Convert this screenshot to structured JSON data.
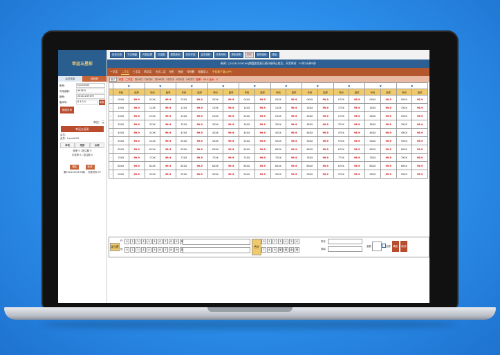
{
  "sidebar": {
    "logo": "幸运五星彩",
    "tabs": [
      "会员信息",
      "游戏规"
    ],
    "account": [
      {
        "k": "账号：",
        "v": "hyceshi05"
      },
      {
        "k": "可用余额：",
        "v": "9938.9"
      },
      {
        "k": "期号：",
        "v": "20241209199"
      },
      {
        "k": "版本号：",
        "v": "8.3.5.5"
      }
    ],
    "refresh_btn": "刷新",
    "balance_btn": "额度查询",
    "unit": "单位：元",
    "title_bar": "幸运五星彩",
    "info": [
      "会员：",
      "会员：hyceshi05"
    ],
    "stat_head": [
      "单笔",
      "限额",
      "余额"
    ],
    "stat_lines": [
      "赔率 0 | 投注额 0",
      "中奖率 0 | 投注额 0"
    ],
    "buttons": [
      "确定",
      "取消"
    ],
    "footer": "第20241209199期 ，开奖时间 07"
  },
  "topnav": {
    "items": [
      "历史记录",
      "下注明细",
      "开奖结果",
      "已结账",
      "报表查询",
      "历史开奖",
      "会员资料",
      "开奖号码",
      "规则说明",
      "打印",
      "修改密码",
      "退出"
    ],
    "active_index": 9
  },
  "notice": "新闻：[20241209199]期盘面信息已经开始停止投注，开奖时间：07时3分钟5秒",
  "playtabs": {
    "items": [
      "一字定",
      "二字定",
      "三字定",
      "四字定",
      "五位二定",
      "快打",
      "快选",
      "号码数",
      "批量导入",
      "手机端下载(APP)"
    ],
    "active_index": 1
  },
  "subtabs": [
    "模式",
    "开奖",
    "二字定",
    "口XX口",
    "口X口X",
    "口XXX口",
    "X口口X",
    "X口X口",
    "XX口口",
    "赔率：99.9 返水：0"
  ],
  "grid": {
    "header": [
      "号码",
      "赔率"
    ],
    "odds": "99.9",
    "columns": [
      [
        "00XX",
        "10XX",
        "20XX",
        "30XX",
        "40XX",
        "50XX",
        "60XX",
        "70XX",
        "80XX",
        "90XX"
      ],
      [
        "01XX",
        "11XX",
        "21XX",
        "31XX",
        "41XX",
        "51XX",
        "61XX",
        "71XX",
        "81XX",
        "91XX"
      ],
      [
        "02XX",
        "12XX",
        "22XX",
        "32XX",
        "42XX",
        "52XX",
        "62XX",
        "72XX",
        "82XX",
        "92XX"
      ],
      [
        "03XX",
        "13XX",
        "23XX",
        "33XX",
        "43XX",
        "53XX",
        "63XX",
        "73XX",
        "83XX",
        "93XX"
      ],
      [
        "04XX",
        "14XX",
        "24XX",
        "34XX",
        "44XX",
        "54XX",
        "64XX",
        "74XX",
        "84XX",
        "94XX"
      ],
      [
        "05XX",
        "15XX",
        "25XX",
        "35XX",
        "45XX",
        "55XX",
        "65XX",
        "75XX",
        "85XX",
        "95XX"
      ],
      [
        "06XX",
        "16XX",
        "26XX",
        "36XX",
        "46XX",
        "56XX",
        "66XX",
        "76XX",
        "86XX",
        "96XX"
      ],
      [
        "07XX",
        "17XX",
        "27XX",
        "37XX",
        "47XX",
        "57XX",
        "67XX",
        "77XX",
        "87XX",
        "97XX"
      ],
      [
        "08XX",
        "18XX",
        "28XX",
        "38XX",
        "48XX",
        "58XX",
        "68XX",
        "78XX",
        "88XX",
        "98XX"
      ],
      [
        "09XX",
        "19XX",
        "29XX",
        "39XX",
        "49XX",
        "59XX",
        "69XX",
        "79XX",
        "89XX",
        "99XX"
      ]
    ]
  },
  "panel": {
    "dingwei_label": "定位置",
    "row1_label": "仟",
    "row2_label": "佰",
    "digits": [
      "0",
      "1",
      "2",
      "3",
      "4",
      "5",
      "6",
      "7",
      "8",
      "9",
      "单",
      "双"
    ],
    "hefen_label": "合分",
    "hefen_digits": [
      "0",
      "1",
      "2",
      "3",
      "4",
      "5",
      "6",
      "7",
      "8",
      "9",
      "单",
      "双",
      "全"
    ],
    "hefen_extra": "清",
    "input1_label": "所有",
    "input2_label": "排除",
    "amount_label": "金额",
    "confirm_btn": "确定",
    "reset_btn": "取消",
    "check_label": "全额"
  },
  "colors": {
    "accent_blue": "#2d5f92",
    "brand_rust": "#b4572d",
    "header_gold": "#f0c96a",
    "odds_red": "#d40000"
  }
}
